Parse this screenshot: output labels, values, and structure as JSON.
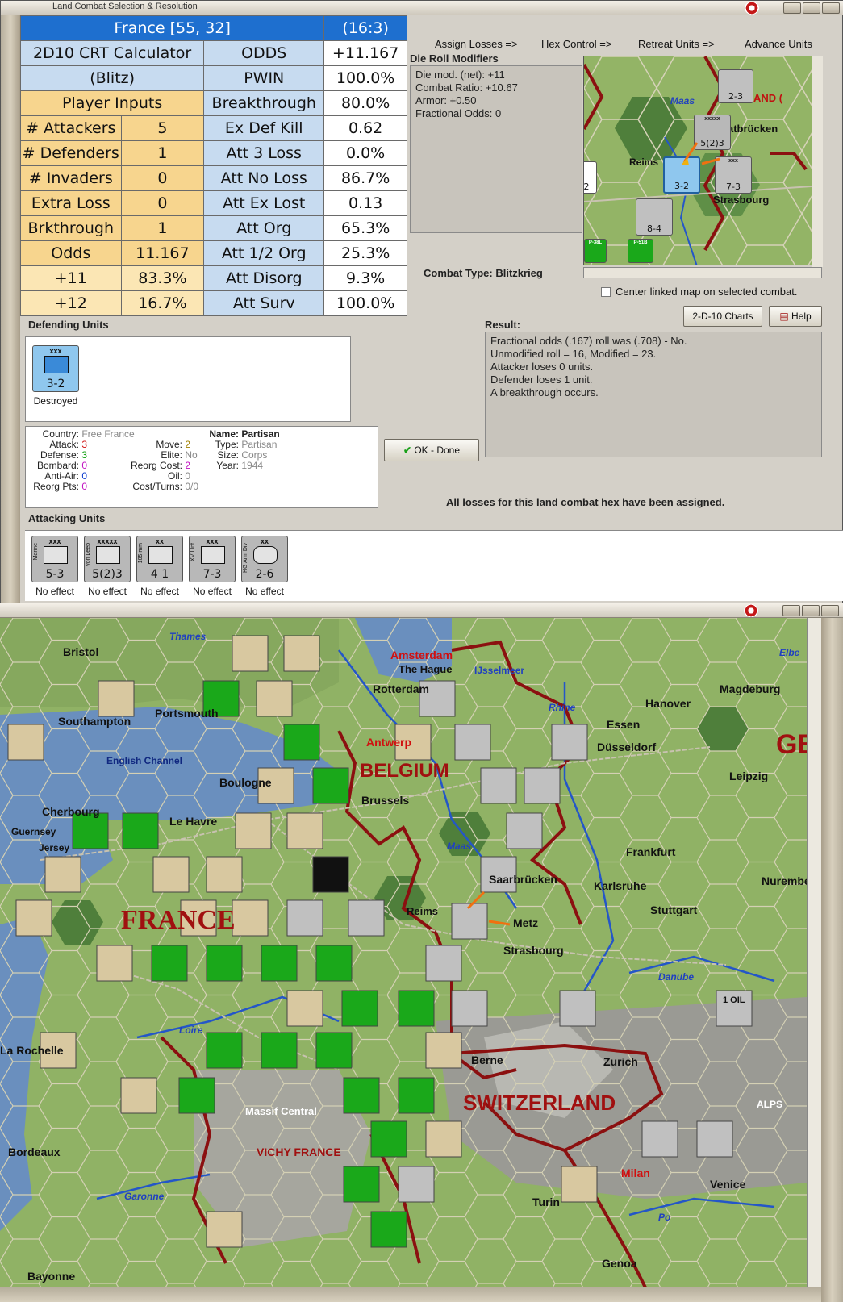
{
  "dialog": {
    "title": "Land Combat Selection & Resolution",
    "hex_title": "France [55, 32]",
    "hex_ratio": "(16:3)"
  },
  "crt": {
    "calc_title": "2D10 CRT Calculator",
    "calc_sub": "(Blitz)",
    "player_inputs": "Player Inputs",
    "rows_left": [
      {
        "label": "# Attackers",
        "value": "5"
      },
      {
        "label": "# Defenders",
        "value": "1"
      },
      {
        "label": "# Invaders",
        "value": "0"
      },
      {
        "label": "Extra Loss",
        "value": "0"
      },
      {
        "label": "Brkthrough",
        "value": "1"
      },
      {
        "label": "Odds",
        "value": "11.167"
      },
      {
        "label": "+11",
        "value": "83.3%"
      },
      {
        "label": "+12",
        "value": "16.7%"
      }
    ],
    "rows_right": [
      {
        "label": "ODDS",
        "value": "+11.167"
      },
      {
        "label": "PWIN",
        "value": "100.0%"
      },
      {
        "label": "Breakthrough",
        "value": "80.0%"
      },
      {
        "label": "Ex Def Kill",
        "value": "0.62"
      },
      {
        "label": "Att 3 Loss",
        "value": "0.0%"
      },
      {
        "label": "Att No Loss",
        "value": "86.7%"
      },
      {
        "label": "Att Ex Lost",
        "value": "0.13"
      },
      {
        "label": "Att Org",
        "value": "65.3%"
      },
      {
        "label": "Att 1/2 Org",
        "value": "25.3%"
      },
      {
        "label": "Att Disorg",
        "value": "9.3%"
      },
      {
        "label": "Att Surv",
        "value": "100.0%"
      }
    ]
  },
  "tabs": [
    "Assign Losses =>",
    "Hex Control =>",
    "Retreat Units =>",
    "Advance Units"
  ],
  "drm": {
    "title": "Die Roll Modifiers",
    "lines": [
      "Die mod. (net): +11",
      "",
      "Combat Ratio: +10.67",
      "Armor: +0.50",
      "Fractional Odds: 0"
    ]
  },
  "mini_map": {
    "labels": [
      "Maas",
      "Reims",
      "Strasbourg",
      "atbrücken",
      "AND ("
    ],
    "counters": [
      "2-3",
      "5(2)3",
      "3-2",
      "7-3",
      "8-4",
      "-2",
      "xxxxx",
      "xxx",
      "P-51B",
      "P-38L"
    ]
  },
  "combat_type": {
    "label": "Combat Type:",
    "value": "Blitzkrieg"
  },
  "center_linked": "Center linked map on selected combat.",
  "buttons": {
    "charts": "2-D-10 Charts",
    "help": "Help",
    "ok": "OK - Done"
  },
  "result": {
    "title": "Result:",
    "lines": [
      "Fractional odds (.167) roll was (.708)  - No.",
      "Unmodified roll = 16, Modified = 23.",
      "Attacker loses 0 units.",
      "Defender loses 1 unit.",
      "A breakthrough occurs."
    ]
  },
  "defending": {
    "title": "Defending Units",
    "unit": {
      "size": "xxx",
      "value": "3-2",
      "status": "Destroyed",
      "color": "#8fc7ee"
    }
  },
  "unit_info": {
    "country": {
      "label": "Country:",
      "value": "Free France"
    },
    "attack": {
      "label": "Attack:",
      "value": "3"
    },
    "defense": {
      "label": "Defense:",
      "value": "3"
    },
    "bombard": {
      "label": "Bombard:",
      "value": "0"
    },
    "anti_air": {
      "label": "Anti-Air:",
      "value": "0"
    },
    "reorg_pts": {
      "label": "Reorg Pts:",
      "value": "0"
    },
    "move": {
      "label": "Move:",
      "value": "2"
    },
    "elite": {
      "label": "Elite:",
      "value": "No"
    },
    "reorg_cost": {
      "label": "Reorg Cost:",
      "value": "2"
    },
    "oil": {
      "label": "Oil:",
      "value": "0"
    },
    "cost_turns": {
      "label": "Cost/Turns:",
      "value": "0/0"
    },
    "name": {
      "label": "Name:",
      "value": "Partisan"
    },
    "type": {
      "label": "Type:",
      "value": "Partisan"
    },
    "size": {
      "label": "Size:",
      "value": "Corps"
    },
    "year": {
      "label": "Year:",
      "value": "1944"
    }
  },
  "all_losses": "All losses for this land combat hex have been assigned.",
  "attacking": {
    "title": "Attacking Units",
    "units": [
      {
        "size": "xxx",
        "side": "Marine",
        "value": "5-3",
        "status": "No effect",
        "color": "#b8b8b8"
      },
      {
        "size": "xxxxx",
        "side": "von Leeb",
        "value": "5(2)3",
        "status": "No effect",
        "color": "#b8b8b8"
      },
      {
        "size": "xx",
        "side": "105 mm",
        "value": "4 1",
        "status": "No effect",
        "color": "#b8b8b8"
      },
      {
        "size": "xxx",
        "side": "XVII Inf",
        "value": "7-3",
        "status": "No effect",
        "color": "#b8b8b8"
      },
      {
        "size": "xx",
        "side": "HG Arm Div",
        "value": "2-6",
        "status": "No effect",
        "color": "#b8b8b8"
      }
    ]
  },
  "map": {
    "countries": [
      "BELGIUM",
      "FRANCE",
      "SWITZERLAND",
      "VICHY FRANCE",
      "GE"
    ],
    "cities": [
      "Bristol",
      "Southampton",
      "Portsmouth",
      "Amsterdam",
      "The Hague",
      "IJsselmeer",
      "Rotterdam",
      "Hanover",
      "Magdeburg",
      "Essen",
      "Düsseldorf",
      "Leipzig",
      "Brussels",
      "Antwerp",
      "Boulogne",
      "Cherbourg",
      "Guernsey",
      "Jersey",
      "Le Havre",
      "Frankfurt",
      "Karlsruhe",
      "Nuremberg",
      "Stuttgart",
      "Metz",
      "Strasbourg",
      "Reims",
      "Saarbrücken",
      "Berne",
      "Zurich",
      "Milan",
      "Venice",
      "Turin",
      "Genoa",
      "Bordeaux",
      "La Rochelle",
      "Bayonne",
      "Massif Central"
    ],
    "rivers": [
      "Thames",
      "Elbe",
      "Rhine",
      "Maas",
      "Danube",
      "Loire",
      "Garonne",
      "Po"
    ],
    "seas": [
      "English Channel"
    ],
    "terrain": [
      "ALPS"
    ],
    "resources": [
      "1 OIL"
    ]
  },
  "colors": {
    "crt_header": "#1e6fcf",
    "crt_light_blue": "#c7dbf0",
    "crt_yellow": "#f7d58e",
    "us_unit": "#1aa81a",
    "german_unit": "#b8b8b8",
    "british_unit": "#d8c8a0",
    "hex_border": "#8b1010"
  }
}
